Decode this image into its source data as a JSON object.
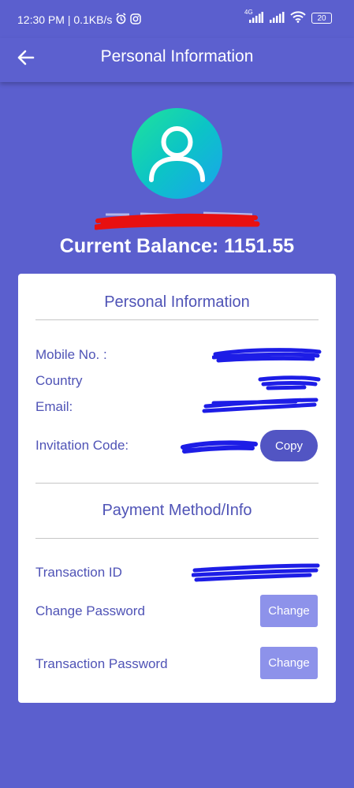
{
  "status_bar": {
    "time_speed": "12:30 PM | 0.1KB/s",
    "network_label": "4G",
    "battery": "20",
    "icons": [
      "alarm-icon",
      "instagram-icon",
      "signal-icon",
      "signal-icon",
      "wifi-icon",
      "battery-icon"
    ]
  },
  "app_bar": {
    "title": "Personal Information",
    "back_icon": "arrow-left-icon"
  },
  "profile": {
    "avatar_icon": "user-icon",
    "balance": "Current Balance: 1151.55"
  },
  "personal_info": {
    "heading": "Personal Information",
    "mobile_label": "Mobile No. :",
    "country_label": "Country",
    "email_label": "Email:",
    "invitation_label": "Invitation Code:",
    "copy_label": "Copy"
  },
  "payment": {
    "heading": "Payment Method/Info",
    "transaction_id_label": "Transaction ID",
    "change_password_label": "Change Password",
    "change_password_button": "Change",
    "transaction_password_label": "Transaction Password",
    "transaction_password_button": "Change"
  },
  "colors": {
    "background": "#5b5fce",
    "accent": "#4f53b6",
    "copy_button": "#5255c3",
    "change_button": "#8d92ea",
    "redaction_blue": "#1d1de6",
    "redaction_red": "#e81010"
  }
}
